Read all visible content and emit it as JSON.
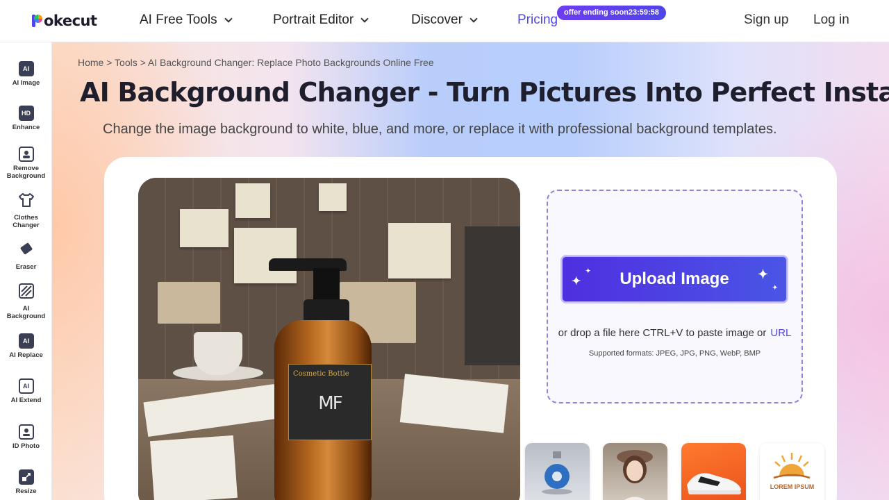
{
  "header": {
    "logo_text": "okecut",
    "nav": [
      {
        "label": "AI Free Tools"
      },
      {
        "label": "Portrait Editor"
      },
      {
        "label": "Discover"
      }
    ],
    "pricing_label": "Pricing",
    "offer_badge": "offer ending soon23:59:58",
    "signup_label": "Sign up",
    "login_label": "Log in"
  },
  "sidebar": {
    "items": [
      {
        "icon_text": "AI",
        "label": "AI Image",
        "icon": "ai-image-icon"
      },
      {
        "icon_text": "HD",
        "label": "Enhance",
        "icon": "hd-enhance-icon"
      },
      {
        "icon_text": "",
        "label": "Remove Background",
        "icon": "remove-background-icon"
      },
      {
        "icon_text": "",
        "label": "Clothes Changer",
        "icon": "tshirt-icon"
      },
      {
        "icon_text": "",
        "label": "Eraser",
        "icon": "eraser-icon"
      },
      {
        "icon_text": "AI",
        "label": "AI Background",
        "icon": "ai-background-icon"
      },
      {
        "icon_text": "AI",
        "label": "AI Replace",
        "icon": "ai-replace-icon"
      },
      {
        "icon_text": "AI",
        "label": "AI Extend",
        "icon": "ai-extend-icon"
      },
      {
        "icon_text": "",
        "label": "ID Photo",
        "icon": "id-photo-icon"
      },
      {
        "icon_text": "",
        "label": "Resize",
        "icon": "resize-icon"
      }
    ]
  },
  "main": {
    "breadcrumb": "Home > Tools > AI Background Changer: Replace Photo Backgrounds Online Free",
    "title": "AI Background Changer - Turn Pictures Into Perfect Instantly",
    "subtitle": "Change the image background to white, blue, and more, or replace it with professional background templates.",
    "hero_label_text": "Cosmetic Bottle",
    "hero_label_mark": "MF",
    "upload": {
      "button_label": "Upload Image",
      "drop_text": "or drop a file here CTRL+V to paste image or",
      "url_label": "URL",
      "formats": "Supported formats: JPEG, JPG, PNG, WebP, BMP"
    },
    "samples": [
      {
        "name": "perfume-bottle"
      },
      {
        "name": "woman-portrait"
      },
      {
        "name": "sneaker"
      },
      {
        "name": "logo",
        "text": "LOREM IPSUM"
      }
    ]
  },
  "colors": {
    "accent": "#4f46e5",
    "button_gradient_start": "#4f2fe0",
    "button_gradient_end": "#4a55e6"
  }
}
